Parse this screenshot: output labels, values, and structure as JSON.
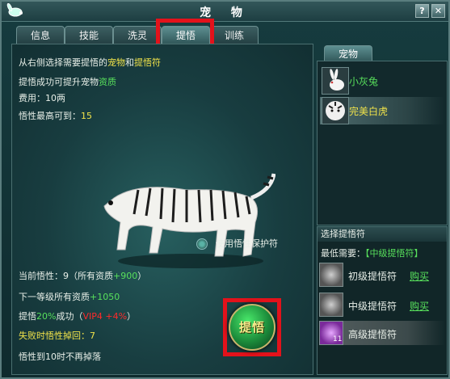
{
  "window": {
    "title": "宠 物",
    "help_label": "?",
    "close_label": "✕"
  },
  "tabs": [
    {
      "label": "信息"
    },
    {
      "label": "技能"
    },
    {
      "label": "洗灵"
    },
    {
      "label": "提悟"
    },
    {
      "label": "训练"
    }
  ],
  "info": {
    "line1": {
      "a": "从右侧选择需要提悟的",
      "pet": "宠物",
      "and": "和",
      "item": "提悟符"
    },
    "line2": {
      "a": "提悟成功可提升宠物",
      "b": "资质"
    },
    "cost": "费用：10两",
    "maxlevel": {
      "a": "悟性最高可到：",
      "b": "15"
    }
  },
  "stats": {
    "current": {
      "a": "当前悟性：9（所有资质",
      "b": "+900",
      "c": "）"
    },
    "next": {
      "a": "下一等级所有资质",
      "b": "+1050"
    },
    "rate": {
      "a": "提悟",
      "b": "20%",
      "c": "成功（",
      "d": "VIP4 +4%",
      "e": "）"
    },
    "fail": "失败时悟性掉回：7",
    "nodrop": "悟性到10时不再掉落"
  },
  "protect_label": "使用悟性保护符",
  "action_button_label": "提悟",
  "pet_panel": {
    "tab": "宠物",
    "pets": [
      {
        "name": "小灰兔",
        "color": "#58e05c"
      },
      {
        "name": "完美白虎",
        "color": "#f1e34a"
      }
    ]
  },
  "charm_panel": {
    "header": "选择提悟符",
    "min_need": {
      "a": "最低需要：",
      "b": "【中级提悟符】"
    },
    "items": [
      {
        "name": "初级提悟符",
        "buy": "购买"
      },
      {
        "name": "中级提悟符",
        "buy": "购买"
      },
      {
        "name": "高级提悟符",
        "count": "11"
      }
    ]
  },
  "colors": {
    "accent_green": "#58e05c",
    "accent_yellow": "#f1e34a",
    "vip_red": "#ff2a2a",
    "highlight_red": "#e3121b"
  }
}
